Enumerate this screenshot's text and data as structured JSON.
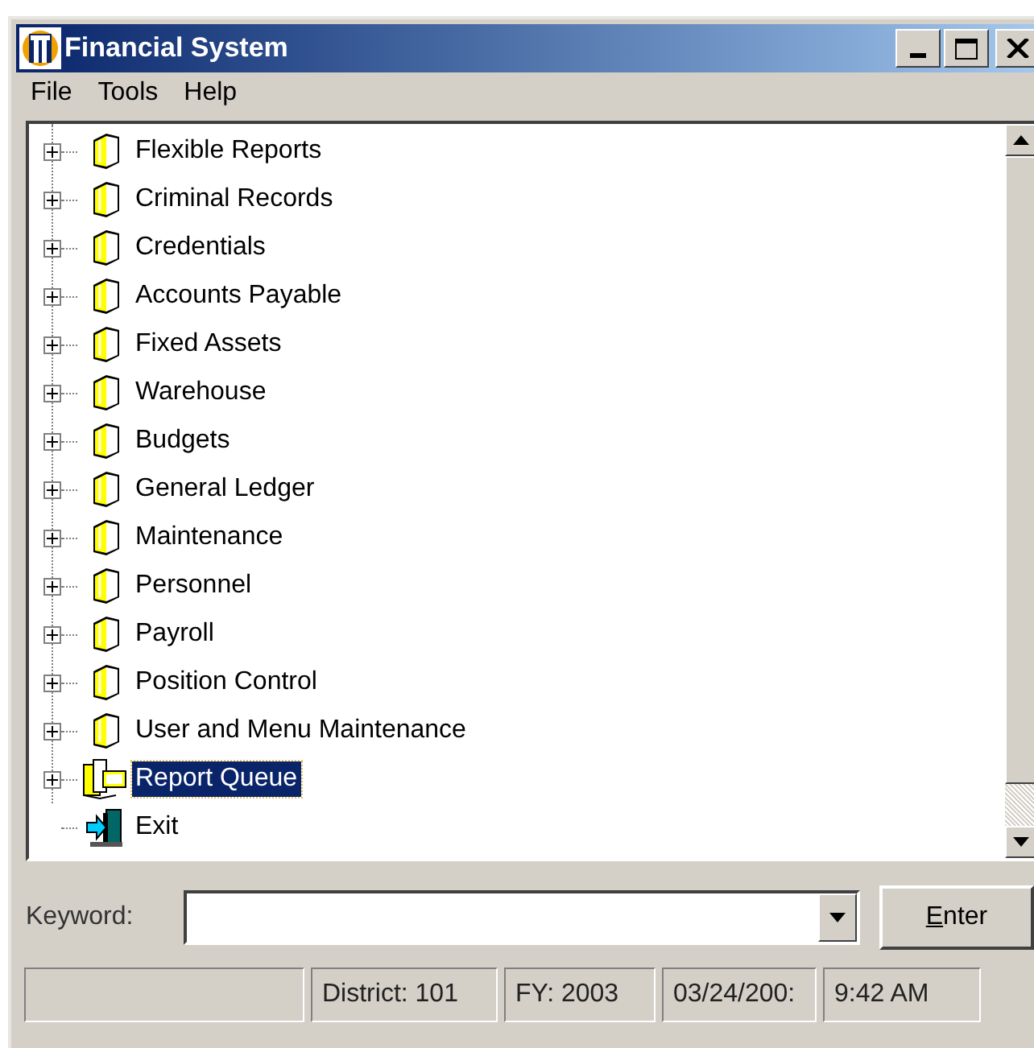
{
  "window": {
    "title": "Financial System"
  },
  "menu": [
    "File",
    "Tools",
    "Help"
  ],
  "tree": [
    {
      "label": "Flexible Reports",
      "kind": "book",
      "expandable": true,
      "selected": false
    },
    {
      "label": "Criminal Records",
      "kind": "book",
      "expandable": true,
      "selected": false
    },
    {
      "label": "Credentials",
      "kind": "book",
      "expandable": true,
      "selected": false
    },
    {
      "label": "Accounts Payable",
      "kind": "book",
      "expandable": true,
      "selected": false
    },
    {
      "label": "Fixed Assets",
      "kind": "book",
      "expandable": true,
      "selected": false
    },
    {
      "label": "Warehouse",
      "kind": "book",
      "expandable": true,
      "selected": false
    },
    {
      "label": "Budgets",
      "kind": "book",
      "expandable": true,
      "selected": false
    },
    {
      "label": "General Ledger",
      "kind": "book",
      "expandable": true,
      "selected": false
    },
    {
      "label": "Maintenance",
      "kind": "book",
      "expandable": true,
      "selected": false
    },
    {
      "label": "Personnel",
      "kind": "book",
      "expandable": true,
      "selected": false
    },
    {
      "label": "Payroll",
      "kind": "book",
      "expandable": true,
      "selected": false
    },
    {
      "label": "Position Control",
      "kind": "book",
      "expandable": true,
      "selected": false
    },
    {
      "label": "User and Menu Maintenance",
      "kind": "book",
      "expandable": true,
      "selected": false
    },
    {
      "label": "Report Queue",
      "kind": "queue",
      "expandable": true,
      "selected": true
    },
    {
      "label": "Exit",
      "kind": "exit",
      "expandable": false,
      "selected": false
    }
  ],
  "keyword": {
    "label": "Keyword:",
    "button": "Enter"
  },
  "status_bar": [
    "District: 101",
    "FY: 2003",
    "03/24/200:",
    "9:42 AM"
  ]
}
